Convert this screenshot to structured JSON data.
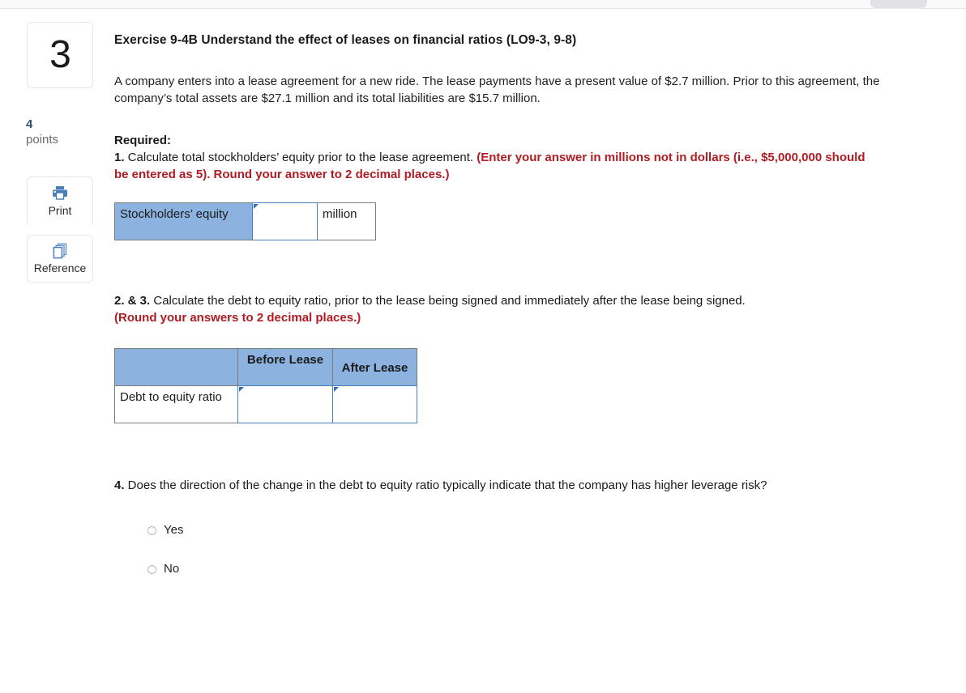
{
  "topbar": {
    "button_label": ""
  },
  "rail": {
    "question_number": "3",
    "points_value": "4",
    "points_label": "points",
    "buttons": [
      {
        "label": "Print",
        "icon": "printer-icon"
      },
      {
        "label": "Reference",
        "icon": "copy-pages-icon"
      }
    ]
  },
  "exercise": {
    "title": "Exercise 9-4B Understand the effect of leases on financial ratios (LO9-3, 9-8)",
    "body": "A company enters into a lease agreement for a new ride. The lease payments have a present value of $2.7 million. Prior to this agreement, the company’s total assets are $27.1 million and its total liabilities are $15.7 million.",
    "required_heading": "Required:",
    "q1_number": "1.",
    "q1_text": " Calculate total stockholders’ equity prior to the lease agreement. ",
    "q1_note": "(Enter your answer in millions not in dollars (i.e., $5,000,000 should be entered as 5). Round your answer to 2 decimal places.)",
    "q23_number": "2. & 3.",
    "q23_text": " Calculate the debt to equity ratio, prior to the lease being signed and immediately after the lease being signed.",
    "q23_note": "(Round your answers to 2 decimal places.)",
    "q4_number": "4.",
    "q4_text": " Does the direction of the change in the debt to equity ratio typically indicate that the company has higher leverage risk?"
  },
  "table1": {
    "row_label": "Stockholders’ equity",
    "answer_value": "",
    "unit_label": "million"
  },
  "table2": {
    "corner_header": "",
    "headers": [
      "Before Lease",
      "After Lease"
    ],
    "row_label": "Debt to equity ratio",
    "values": [
      "",
      ""
    ]
  },
  "answer_options": [
    {
      "label": "Yes",
      "selected": false
    },
    {
      "label": "No",
      "selected": false
    }
  ],
  "colors": {
    "header_blue": "#8cb3e0",
    "input_border_blue": "#4a7ebb",
    "note_red": "#b01c23",
    "points_blue": "#2f4f73"
  }
}
